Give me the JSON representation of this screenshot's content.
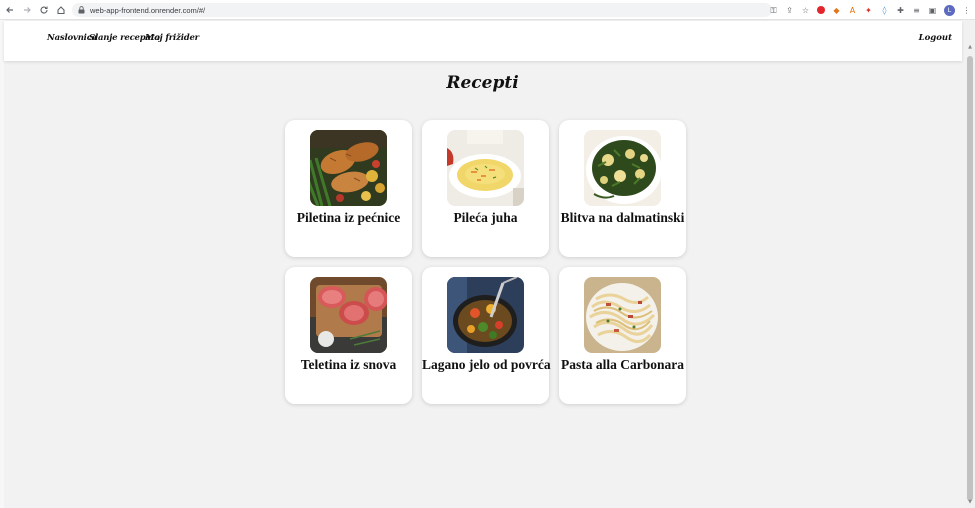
{
  "browser": {
    "url": "web-app-frontend.onrender.com/#/",
    "avatar_letter": "L"
  },
  "nav": {
    "home": "Naslovnica",
    "compose": "Slanje recepata",
    "fridge": "Moj frižider",
    "logout": "Logout"
  },
  "page": {
    "title": "Recepti"
  },
  "recipes": [
    {
      "title": "Piletina iz pećnice",
      "image": "roast-chicken-photo"
    },
    {
      "title": "Pileća juha",
      "image": "chicken-soup-photo"
    },
    {
      "title": "Blitva na dalmatinski",
      "image": "chard-potatoes-photo"
    },
    {
      "title": "Teletina iz snova",
      "image": "veal-steaks-photo"
    },
    {
      "title": "Lagano jelo od povrća",
      "image": "vegetable-pan-photo"
    },
    {
      "title": "Pasta alla Carbonara",
      "image": "carbonara-photo"
    }
  ]
}
